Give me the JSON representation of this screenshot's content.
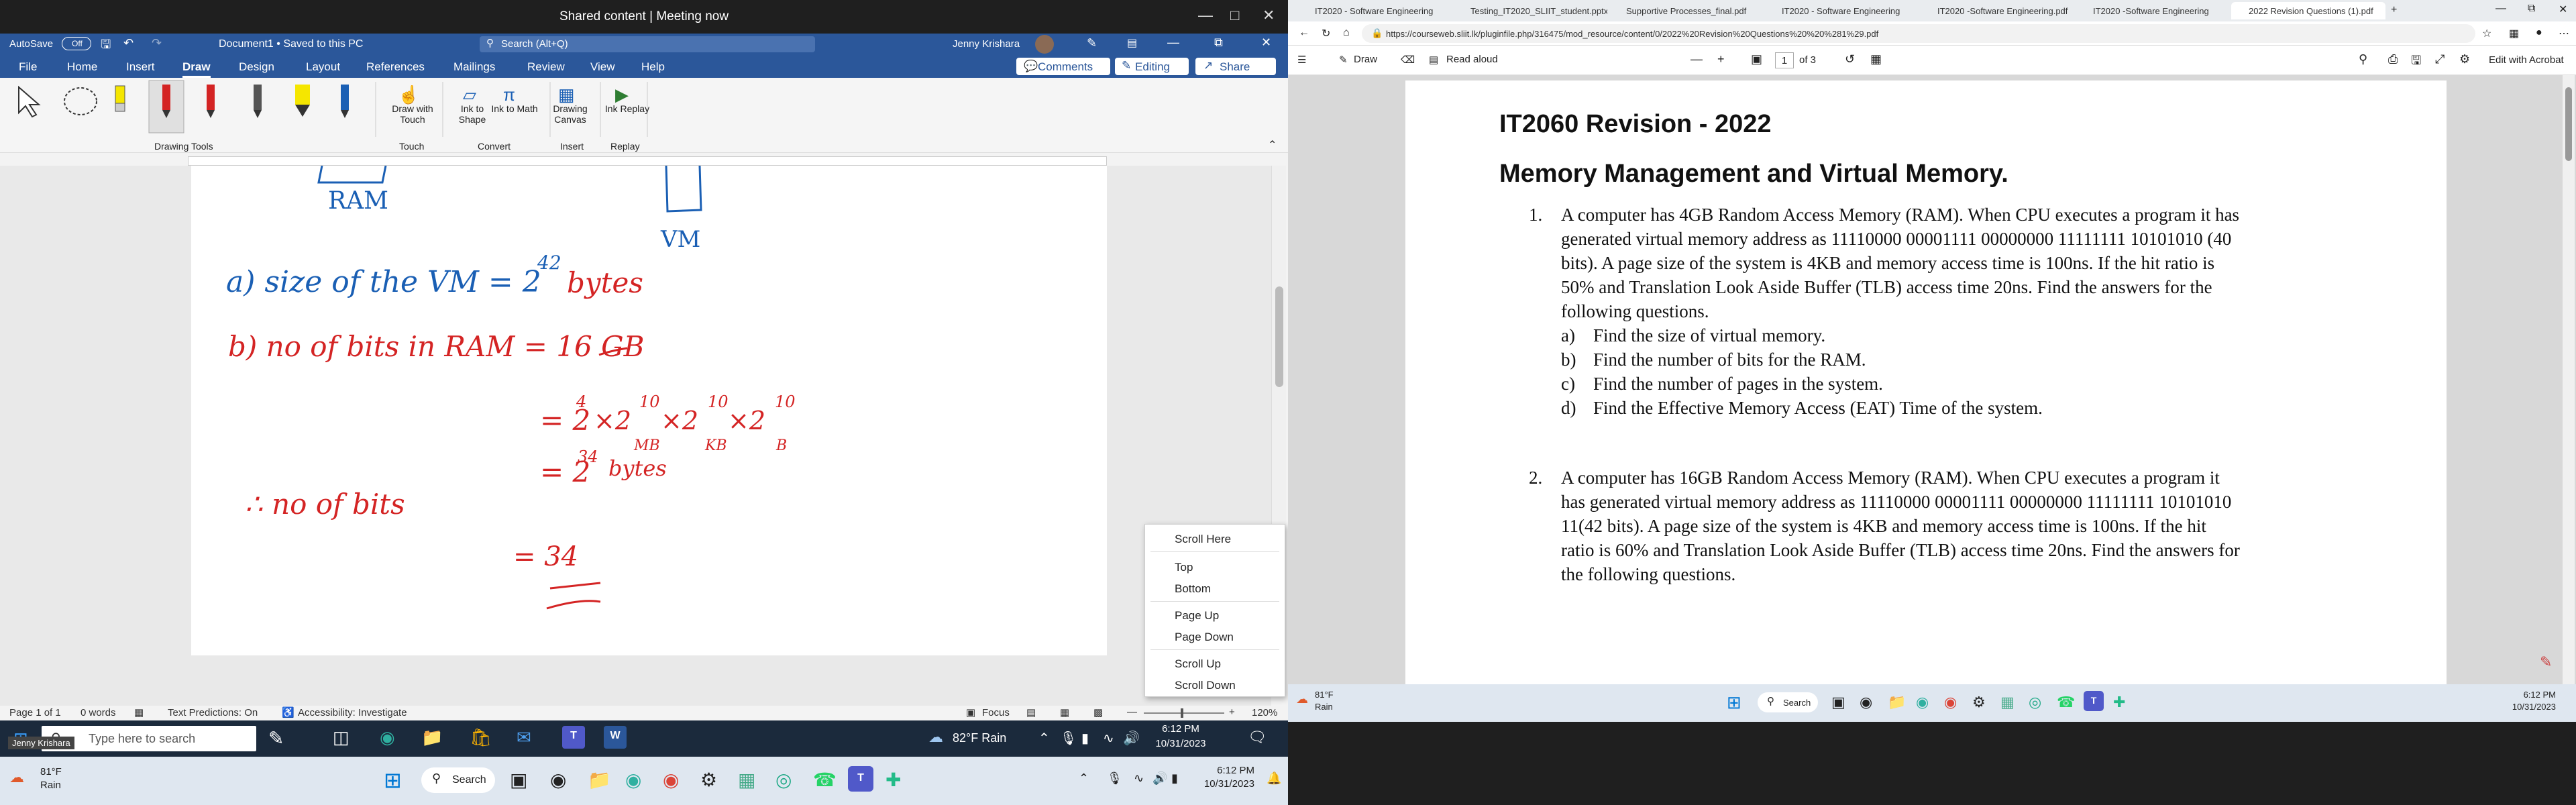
{
  "meeting": {
    "title": "Shared content | Meeting now"
  },
  "word": {
    "autosave_label": "AutoSave",
    "autosave_state": "Off",
    "doc_title": "Document1 • Saved to this PC",
    "search_placeholder": "Search (Alt+Q)",
    "user_name": "Jenny Krishara",
    "tabs": [
      "File",
      "Home",
      "Insert",
      "Draw",
      "Design",
      "Layout",
      "References",
      "Mailings",
      "Review",
      "View",
      "Help"
    ],
    "active_tab": "Draw",
    "comments_label": "Comments",
    "editing_label": "Editing",
    "share_label": "Share",
    "groups": {
      "drawing_tools": "Drawing Tools",
      "touch": "Touch",
      "convert": "Convert",
      "insert": "Insert",
      "replay": "Replay"
    },
    "buttons": {
      "draw_touch": "Draw with Touch",
      "ink_shape": "Ink to Shape",
      "ink_math": "Ink to Math",
      "drawing_canvas": "Drawing Canvas",
      "ink_replay": "Ink Replay"
    },
    "handwriting": {
      "ram_label": "RAM",
      "vm_label": "VM",
      "line_a_text": "a) size of the VM = 2",
      "line_a_exp": "42",
      "line_a_unit": "bytes",
      "line_b_text": "b) no of bits in RAM = 16 GB",
      "line_c_text": "= 2",
      "line_c_parts": [
        "4",
        "10",
        "10",
        "10"
      ],
      "line_c_units": [
        "MB",
        "KB",
        "B"
      ],
      "line_d_text": "= 2",
      "line_d_exp": "34",
      "line_d_unit": "bytes",
      "line_e_text": "∴ no of bits",
      "line_e_value": "= 34"
    },
    "status": {
      "page": "Page 1 of 1",
      "words": "0 words",
      "text_predictions": "Text Predictions: On",
      "accessibility": "Accessibility: Investigate",
      "focus": "Focus",
      "zoom": "120%"
    }
  },
  "context_menu": {
    "items": [
      "Scroll Here",
      "Top",
      "Bottom",
      "Page Up",
      "Page Down",
      "Scroll Up",
      "Scroll Down"
    ]
  },
  "taskbar_left": {
    "search_placeholder": "Type here to search",
    "weather": "82°F  Rain",
    "time": "6:12 PM",
    "date": "10/31/2023",
    "tooltip": "Jenny Krishara"
  },
  "taskbar_bottom": {
    "weather_temp": "81°F",
    "weather_desc": "Rain",
    "search_label": "Search",
    "time": "6:12 PM",
    "date": "10/31/2023"
  },
  "browser": {
    "tabs": [
      "IT2020 - Software Engineering",
      "Testing_IT2020_SLIIT_student.pptx",
      "Supportive Processes_final.pdf",
      "IT2020 - Software Engineering",
      "IT2020 -Software Engineering.pdf",
      "IT2020 -Software Engineering",
      "2022 Revision Questions (1).pdf"
    ],
    "active_tab_index": 6,
    "url": "https://courseweb.sliit.lk/pluginfile.php/316475/mod_resource/content/0/2022%20Revision%20Questions%20%20%281%29.pdf",
    "pdf_toolbar": {
      "draw": "Draw",
      "read_aloud": "Read aloud",
      "page_current": "1",
      "page_total": "of 3",
      "edit_acrobat": "Edit with Acrobat"
    }
  },
  "pdf": {
    "title": "IT2060 Revision - 2022",
    "subtitle": "Memory Management and Virtual Memory.",
    "q1": {
      "num": "1.",
      "text": [
        "A computer has 4GB Random Access Memory (RAM). When CPU executes a program it has",
        "generated virtual memory address as 11110000 00001111 00000000 11111111 10101010 (40",
        "bits). A page size of the system is 4KB and memory access time is 100ns. If the hit ratio is",
        "50% and Translation Look Aside Buffer (TLB) access time 20ns. Find the answers for the",
        "following questions."
      ],
      "parts": [
        {
          "label": "a)",
          "text": "Find the size of virtual memory."
        },
        {
          "label": "b)",
          "text": "Find the number of bits for the RAM."
        },
        {
          "label": "c)",
          "text": "Find the number of pages in the system."
        },
        {
          "label": "d)",
          "text": "Find the Effective Memory Access (EAT) Time of the system."
        }
      ]
    },
    "q2": {
      "num": "2.",
      "text": [
        "A computer has 16GB Random Access Memory (RAM). When CPU executes a program it",
        "has generated virtual memory address as 11110000 00001111 00000000 11111111 10101010",
        "11(42 bits). A page size of the system is 4KB and memory access time is 100ns. If the hit",
        "ratio is 60% and Translation Look Aside Buffer (TLB) access time 20ns. Find the answers for",
        "the following questions."
      ]
    }
  },
  "taskbar_right": {
    "weather_temp": "81°F",
    "weather_desc": "Rain",
    "search_label": "Search",
    "time": "6:12 PM",
    "date": "10/31/2023"
  },
  "colors": {
    "word_blue": "#2b579a",
    "ink_red": "#d42424",
    "ink_blue": "#1a5fb4"
  }
}
